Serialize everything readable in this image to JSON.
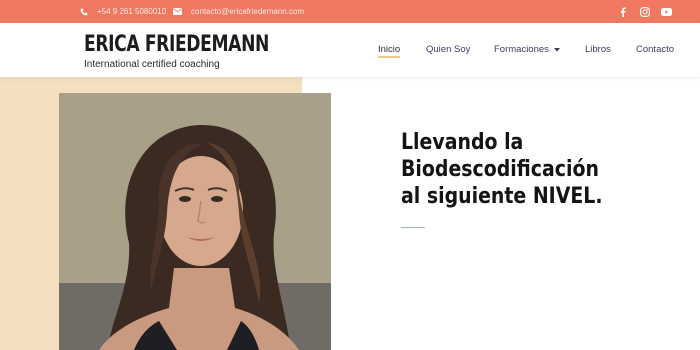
{
  "topbar": {
    "phone": "+54 9 261 5080010",
    "email": "contacto@ericafriedemann.com",
    "phone_icon": "phone-icon",
    "email_icon": "envelope-icon",
    "social": [
      "facebook-icon",
      "instagram-icon",
      "youtube-icon"
    ],
    "bg_color": "#f07861"
  },
  "header": {
    "logo_title": "ERICA FRIEDEMANN",
    "logo_subtitle": "International certified coaching"
  },
  "nav": {
    "items": [
      {
        "label": "Inicio",
        "active": true
      },
      {
        "label": "Quien Soy"
      },
      {
        "label": "Formaciones",
        "has_dropdown": true
      },
      {
        "label": "Libros"
      },
      {
        "label": "Contacto"
      }
    ],
    "active_underline_color": "#f0c58a"
  },
  "hero": {
    "headline": [
      "Llevando la",
      "Biodescodificación",
      "al siguiente NIVEL."
    ],
    "accent_bg": "#f4dfc0"
  }
}
